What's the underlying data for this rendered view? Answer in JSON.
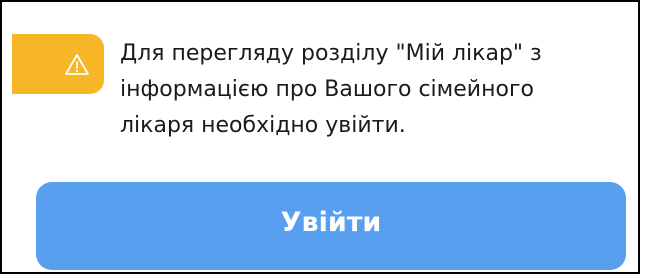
{
  "notice": {
    "icon": "warning-icon",
    "accent_color": "#f6b626",
    "lines": [
      "Для перегляду розділу \"Мій лікар\" з",
      "інформацією про Вашого сімейного",
      "лікаря необхідно увійти."
    ]
  },
  "login_button": {
    "label": "Увійти",
    "color": "#589ff0"
  }
}
